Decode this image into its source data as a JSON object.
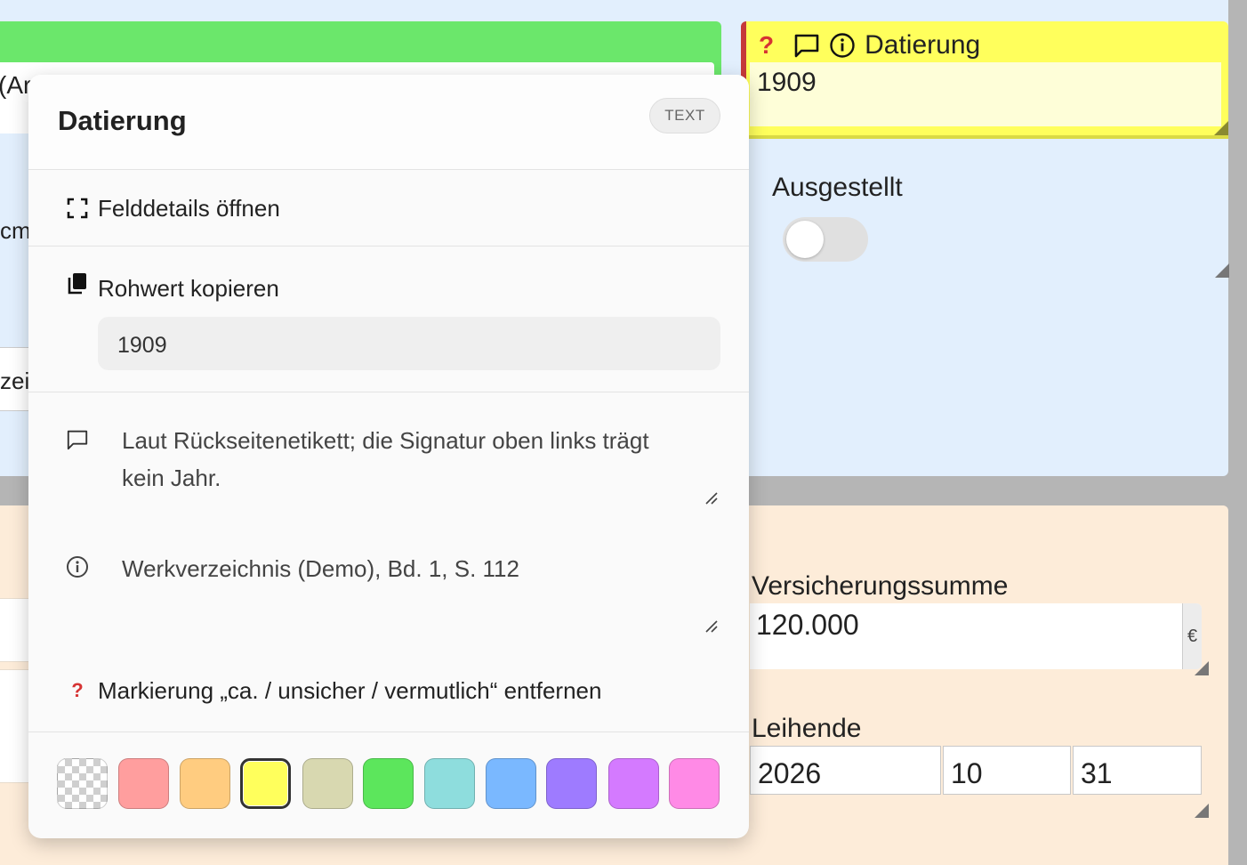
{
  "background": {
    "green_field_value_fragment": "(Ar",
    "cm_fragment": "cm",
    "zei_fragment": "zei"
  },
  "datierung_field": {
    "title": "Datierung",
    "value": "1909",
    "icons": [
      "question-mark-icon",
      "comment-icon",
      "info-icon"
    ],
    "color": "#ffff5c"
  },
  "ausgestellt": {
    "label": "Ausgestellt",
    "checked": false
  },
  "versicherungssumme": {
    "label": "Versicherungssumme",
    "value": "120.000",
    "unit": "€"
  },
  "leihende": {
    "label": "Leihende",
    "year": "2026",
    "month": "10",
    "day": "31"
  },
  "popup": {
    "title": "Datierung",
    "type_badge": "TEXT",
    "open_details": "Felddetails öffnen",
    "copy_raw": "Rohwert kopieren",
    "raw_value": "1909",
    "comment_line1": "Laut Rückseitenetikett; die Signatur oben links trägt",
    "comment_line2": "kein Jahr.",
    "source": "Werkverzeichnis (Demo), Bd. 1, S. 112",
    "remove_mark": "Markierung „ca. / unsicher / vermutlich“ entfernen",
    "colors": [
      {
        "name": "none",
        "hex": "transparent"
      },
      {
        "name": "red",
        "hex": "#ff9e9e"
      },
      {
        "name": "orange",
        "hex": "#ffcc80"
      },
      {
        "name": "yellow",
        "hex": "#ffff5c"
      },
      {
        "name": "olive",
        "hex": "#d8d8b0"
      },
      {
        "name": "green",
        "hex": "#5ce65c"
      },
      {
        "name": "teal",
        "hex": "#8edddd"
      },
      {
        "name": "blue",
        "hex": "#7ab8ff"
      },
      {
        "name": "violet",
        "hex": "#9e7bff"
      },
      {
        "name": "purple",
        "hex": "#d47aff"
      },
      {
        "name": "pink",
        "hex": "#ff8ae6"
      }
    ],
    "selected_color": "yellow"
  }
}
